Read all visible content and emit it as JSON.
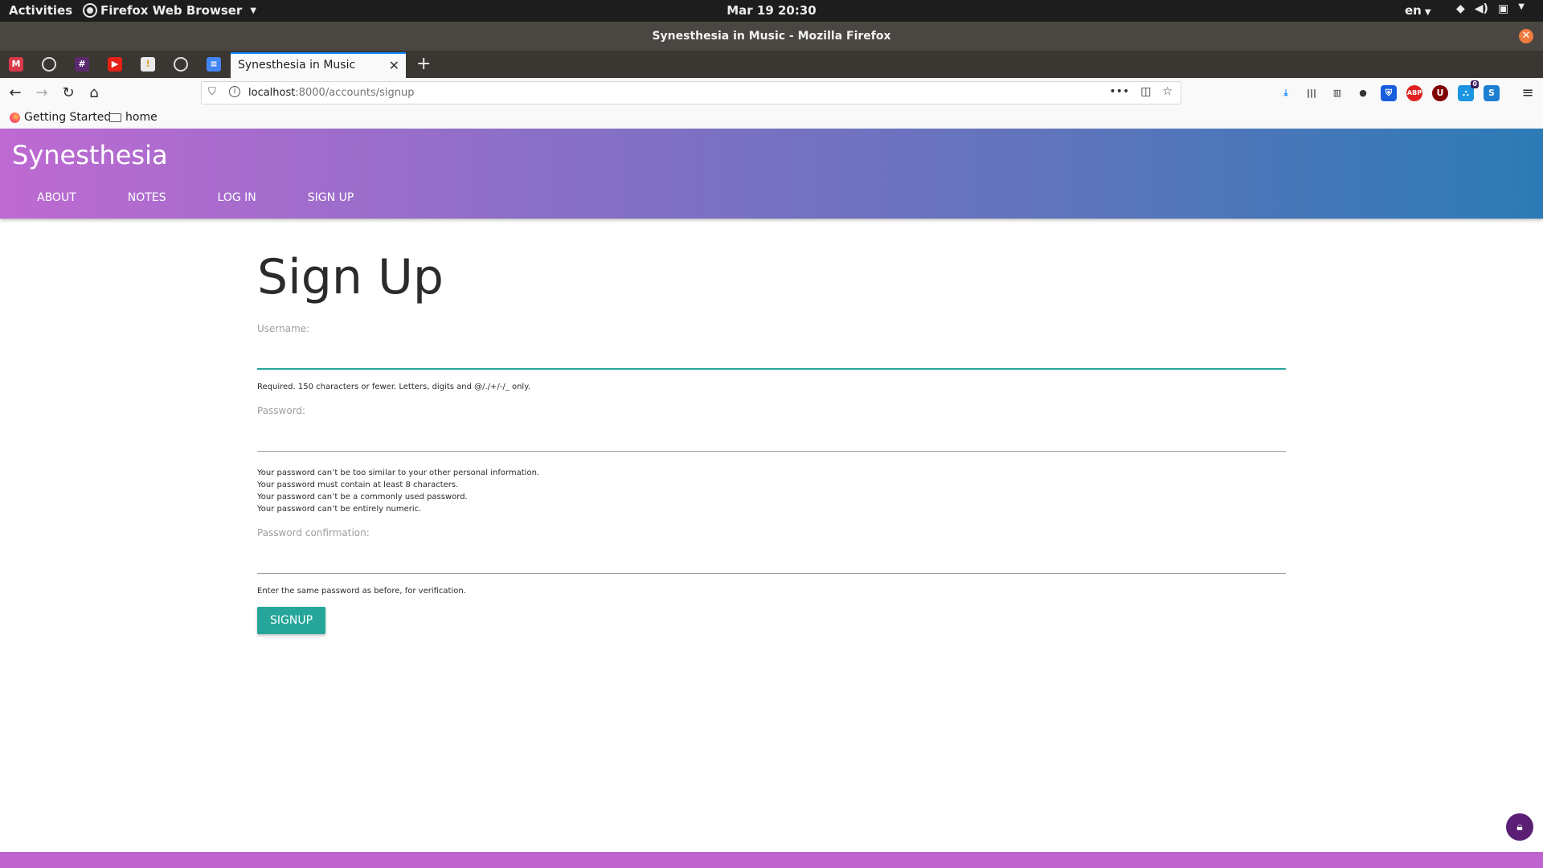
{
  "system": {
    "activities": "Activities",
    "app_menu": "Firefox Web Browser",
    "clock": "Mar 19  20:30",
    "lang": "en"
  },
  "window": {
    "title": "Synesthesia in Music - Mozilla Firefox"
  },
  "tabs": {
    "active_title": "Synesthesia in Music"
  },
  "navbar": {
    "url_host": "localhost",
    "url_rest": ":8000/accounts/signup"
  },
  "bookmarks": {
    "getting_started": "Getting Started",
    "home": "home"
  },
  "site": {
    "brand": "Synesthesia",
    "nav": [
      "ABOUT",
      "NOTES",
      "LOG IN",
      "SIGN UP"
    ]
  },
  "form": {
    "heading": "Sign Up",
    "username_label": "Username:",
    "username_help": "Required. 150 characters or fewer. Letters, digits and @/./+/-/_ only.",
    "password_label": "Password:",
    "password_help": [
      "Your password can’t be too similar to your other personal information.",
      "Your password must contain at least 8 characters.",
      "Your password can’t be a commonly used password.",
      "Your password can’t be entirely numeric."
    ],
    "password_confirm_label": "Password confirmation:",
    "password_confirm_help": "Enter the same password as before, for verification.",
    "submit_label": "SIGNUP"
  },
  "toolbar_badge": "0"
}
